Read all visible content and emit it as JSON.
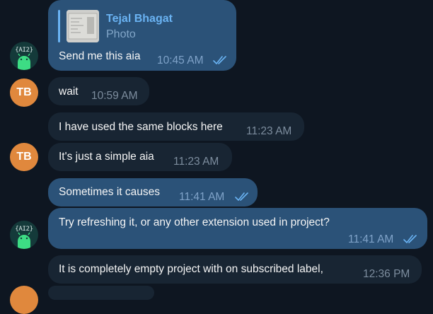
{
  "messages": [
    {
      "text": "Send me this aia",
      "time": "10:45 AM",
      "reply": {
        "name": "Tejal Bhagat",
        "label": "Photo"
      }
    },
    {
      "text": "wait",
      "time": "10:59 AM",
      "avatar": "TB"
    },
    {
      "text": "I have used the same blocks here",
      "time": "11:23 AM"
    },
    {
      "text": "It's just a simple aia",
      "time": "11:23 AM",
      "avatar": "TB"
    },
    {
      "text": "Sometimes it causes",
      "time": "11:41 AM"
    },
    {
      "text": "Try refreshing it, or any other extension used in project?",
      "time": "11:41 AM"
    },
    {
      "text": "It is completely empty project with on subscribed label,",
      "time": "12:36 PM"
    }
  ],
  "ai_avatar_label": "{AI2}",
  "colors": {
    "background": "#0e1621",
    "outgoing_bubble": "#2b5278",
    "incoming_bubble": "#182533",
    "reply_accent": "#6ab3f3",
    "tb_avatar": "#e0883d",
    "robot_green": "#3ddc84"
  },
  "icons": {
    "read_receipt": "double-check-icon",
    "ai_avatar": "android-robot-icon"
  }
}
